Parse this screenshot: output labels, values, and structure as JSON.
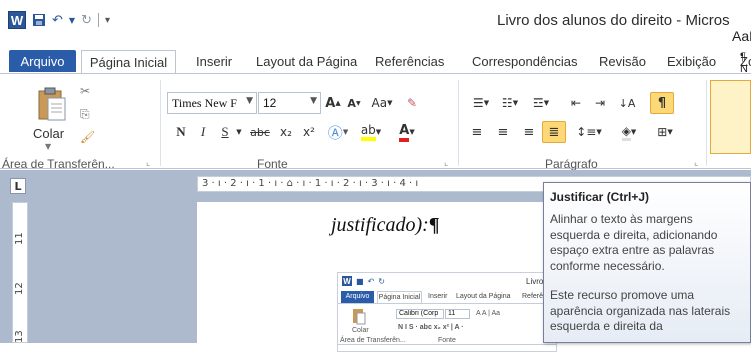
{
  "window": {
    "title": "Livro dos alunos do direito - Micros",
    "app_letter": "W"
  },
  "quick_access": {
    "save_icon": "save-icon",
    "undo_icon": "undo-icon",
    "redo_icon": "redo-icon",
    "customize_icon": "customize-qat-icon"
  },
  "tabs": [
    {
      "label": "Arquivo"
    },
    {
      "label": "Página Inicial"
    },
    {
      "label": "Inserir"
    },
    {
      "label": "Layout da Página"
    },
    {
      "label": "Referências"
    },
    {
      "label": "Correspondências"
    },
    {
      "label": "Revisão"
    },
    {
      "label": "Exibição"
    },
    {
      "label": "Zo"
    }
  ],
  "ribbon": {
    "clipboard": {
      "paste_label": "Colar",
      "group_label": "Área de Transferên..."
    },
    "font": {
      "font_name": "Times New F",
      "font_size": "12",
      "grow": "A",
      "shrink": "A",
      "case": "Aa",
      "bold": "N",
      "italic": "I",
      "underline": "S",
      "strike": "abc",
      "subscript": "x₂",
      "superscript": "x²",
      "group_label": "Fonte"
    },
    "paragraph": {
      "group_label": "Parágrafo"
    },
    "styles": {
      "sample": "AaBl",
      "name": "¶ N"
    }
  },
  "ruler": {
    "horizontal": "3 · ı · 2 · ı · 1 · ı · ⌂ · ı · 1 · ı · 2 · ı · 3 · ı · 4 · ı",
    "vertical": [
      "11",
      "12",
      "13"
    ],
    "corner": "L"
  },
  "document": {
    "text": "justificado):",
    "pilcrow": "¶"
  },
  "embedded": {
    "title": "Livro d",
    "tabs": [
      "Arquivo",
      "Página Inicial",
      "Inserir",
      "Layout da Página",
      "Referê"
    ],
    "font_name": "Calibri (Corp",
    "font_size": "11",
    "paste_label": "Colar",
    "group1": "Área de Transferên...",
    "group2": "Fonte"
  },
  "tooltip": {
    "title": "Justificar (Ctrl+J)",
    "paragraph1": "Alinhar o texto às margens esquerda e direita, adicionando espaço extra entre as palavras conforme necessário.",
    "paragraph2": "Este recurso promove uma aparência organizada nas laterais esquerda e direita da"
  },
  "colors": {
    "accent": "#2a5caa",
    "active_button": "#fcd876",
    "highlight_yellow": "#ffff00",
    "font_red": "#e02020"
  }
}
